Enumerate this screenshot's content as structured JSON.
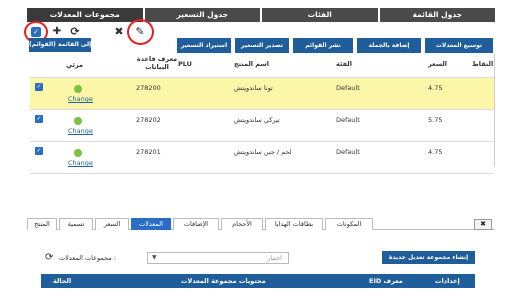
{
  "top_tabs": [
    "جدول القائمة",
    "الفئات",
    "جدول التسعير",
    "مجموعات المعدلات"
  ],
  "toolbar": {
    "checkbox_glyph": "✓",
    "plus_glyph": "✚",
    "refresh_glyph": "⟳",
    "delete_glyph": "✖",
    "edit_glyph": "✎"
  },
  "action_buttons": [
    "توسيع المعدلات",
    "إضافة بالجملة",
    "نشر القوائم",
    "تصدير التسعير",
    "استيراد التسعير",
    "إضافة إلى القائمة (القوائم)"
  ],
  "grid": {
    "headers": {
      "plu": "PLU",
      "visible": "مرئي",
      "db_id": "معرف قاعدة البيانات",
      "product_name": "اسم المنتج",
      "category": "الفئة",
      "price": "السعر",
      "points": "النقاط"
    },
    "change_label": "Change",
    "rows": [
      {
        "db_id": "278200",
        "name": "تونا ساندويتش",
        "category": "Default",
        "price": "4.75",
        "selected": true
      },
      {
        "db_id": "278202",
        "name": "تيركي ساندويتش",
        "category": "Default",
        "price": "5.75",
        "selected": false
      },
      {
        "db_id": "278201",
        "name": "لحم / جبن ساندويتش",
        "category": "Default",
        "price": "4.75",
        "selected": false
      }
    ]
  },
  "bottom": {
    "close_glyph": "✖",
    "tabs": [
      "المنتج",
      "تسمية",
      "السعر",
      "المعدلات",
      "الإضافات",
      "الأحجام",
      "بطاقات الهدايا",
      "المكونات"
    ],
    "active_tab": "المعدلات",
    "group_label": "مجموعات المعدلات :",
    "select_placeholder": "اختيار",
    "new_group_button": "إنشاء مجموعة تعديل جديدة",
    "table_headers": [
      "الحالة",
      "محتويات مجموعة المعدلات",
      "EID معرف",
      "إعدادات"
    ]
  },
  "colors": {
    "accent": "#1f5e9a",
    "highlight": "#fcf6a9",
    "tab_bar": "#4a4a4a",
    "circle": "#e52121",
    "status_green": "#7ac23f"
  }
}
